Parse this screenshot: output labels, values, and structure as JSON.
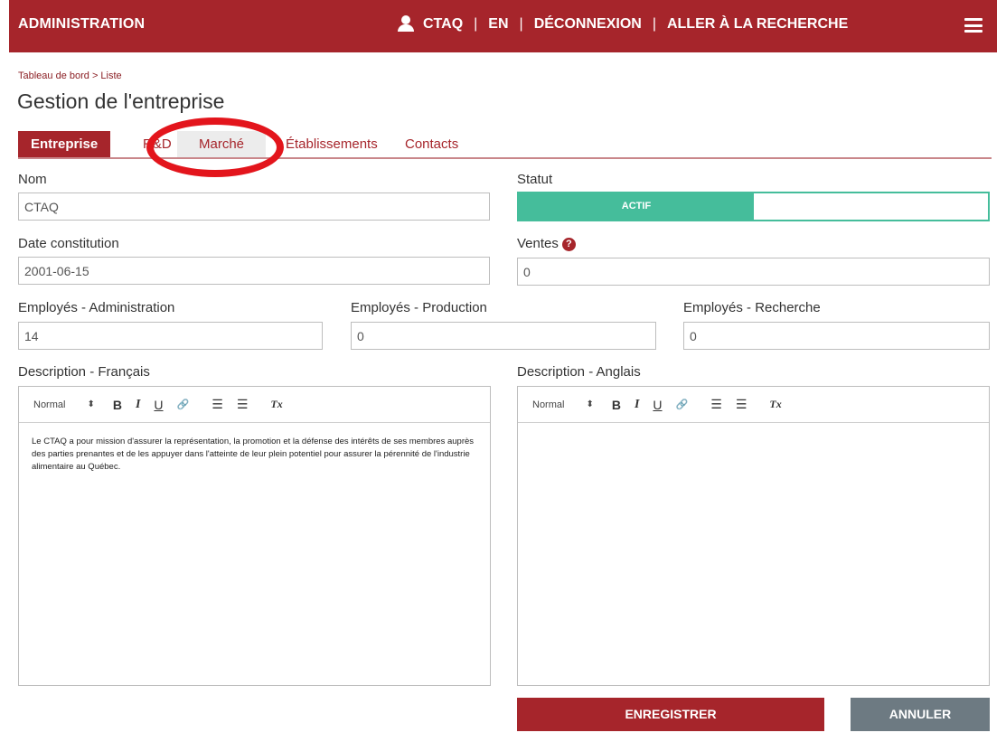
{
  "topbar": {
    "brand": "ADMINISTRATION",
    "user": "CTAQ",
    "lang": "EN",
    "logout": "DÉCONNEXION",
    "search": "ALLER À LA RECHERCHE",
    "separator": "|"
  },
  "breadcrumb": "Tableau de bord > Liste",
  "page_title": "Gestion de l'entreprise",
  "tabs": [
    "Entreprise",
    "R&D",
    "Marché",
    "Établissements",
    "Contacts"
  ],
  "form": {
    "nom_label": "Nom",
    "nom_value": "CTAQ",
    "statut_label": "Statut",
    "statut_value": "ACTIF",
    "date_label": "Date constitution",
    "date_value": "2001-06-15",
    "ventes_label": "Ventes",
    "ventes_value": "0",
    "emp_admin_label": "Employés - Administration",
    "emp_admin_value": "14",
    "emp_prod_label": "Employés - Production",
    "emp_prod_value": "0",
    "emp_rech_label": "Employés - Recherche",
    "emp_rech_value": "0",
    "desc_fr_label": "Description - Français",
    "desc_en_label": "Description - Anglais",
    "desc_fr_value": "Le CTAQ a pour mission d'assurer la représentation, la promotion et la défense des intérêts de ses membres auprès des parties prenantes et de les appuyer dans l'atteinte de leur plein potentiel pour assurer la pérennité de l'industrie alimentaire au Québec.",
    "desc_en_value": ""
  },
  "editor_toolbar": {
    "format": "Normal",
    "arrow": "⬍",
    "bold": "B",
    "italic": "I",
    "underline": "U",
    "link": "🔗",
    "ordered": "☰",
    "bullet": "☰",
    "clear": "Tx"
  },
  "buttons": {
    "save": "ENREGISTRER",
    "cancel": "ANNULER"
  },
  "colors": {
    "brand": "#a6252b",
    "status_active": "#45bd9b",
    "cancel": "#6d7a82",
    "annotation": "#e3151c"
  }
}
